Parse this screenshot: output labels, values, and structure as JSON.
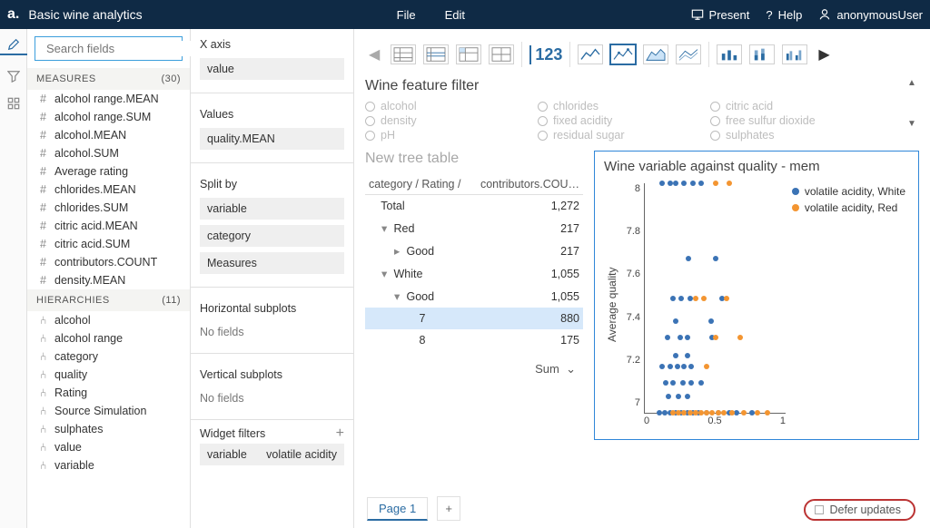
{
  "header": {
    "logo": "a.",
    "title": "Basic wine analytics",
    "menu": [
      "File",
      "Edit"
    ],
    "present": "Present",
    "help": "Help",
    "user": "anonymousUser"
  },
  "search": {
    "placeholder": "Search fields"
  },
  "measures": {
    "title": "MEASURES",
    "count": "(30)",
    "items": [
      "alcohol range.MEAN",
      "alcohol range.SUM",
      "alcohol.MEAN",
      "alcohol.SUM",
      "Average rating",
      "chlorides.MEAN",
      "chlorides.SUM",
      "citric acid.MEAN",
      "citric acid.SUM",
      "contributors.COUNT",
      "density.MEAN"
    ]
  },
  "hierarchies": {
    "title": "HIERARCHIES",
    "count": "(11)",
    "items": [
      "alcohol",
      "alcohol range",
      "category",
      "quality",
      "Rating",
      "Source Simulation",
      "sulphates",
      "value",
      "variable"
    ]
  },
  "config": {
    "x_axis_label": "X axis",
    "x_axis_chip": "value",
    "values_label": "Values",
    "values_chip": "quality.MEAN",
    "split_label": "Split by",
    "split_chips": [
      "variable",
      "category",
      "Measures"
    ],
    "h_sub_label": "Horizontal subplots",
    "v_sub_label": "Vertical subplots",
    "no_fields": "No fields",
    "filters_label": "Widget filters",
    "filter_chip_key": "variable",
    "filter_chip_val": "volatile acidity"
  },
  "toolbar_number": "123",
  "filter": {
    "title": "Wine feature filter",
    "items": [
      "alcohol",
      "chlorides",
      "citric acid",
      "density",
      "fixed acidity",
      "free sulfur dioxide",
      "pH",
      "residual sugar",
      "sulphates"
    ]
  },
  "table": {
    "title": "New tree table",
    "col1": "category / Rating / ",
    "col2": "contributors.COU…",
    "rows": [
      {
        "label": "Total",
        "value": "1,272",
        "indent": 0,
        "caret": "",
        "sel": false
      },
      {
        "label": "Red",
        "value": "217",
        "indent": 1,
        "caret": "▾",
        "sel": false
      },
      {
        "label": "Good",
        "value": "217",
        "indent": 2,
        "caret": "▸",
        "sel": false
      },
      {
        "label": "White",
        "value": "1,055",
        "indent": 1,
        "caret": "▾",
        "sel": false
      },
      {
        "label": "Good",
        "value": "1,055",
        "indent": 2,
        "caret": "▾",
        "sel": false
      },
      {
        "label": "7",
        "value": "880",
        "indent": 3,
        "caret": "",
        "sel": true
      },
      {
        "label": "8",
        "value": "175",
        "indent": 3,
        "caret": "",
        "sel": false
      }
    ],
    "sum": "Sum"
  },
  "chart": {
    "title": "Wine variable against quality - mem",
    "ylabel": "Average quality",
    "legend": [
      "volatile acidity, White",
      "volatile acidity, Red"
    ]
  },
  "chart_data": {
    "type": "scatter",
    "title": "Wine variable against quality - mem",
    "xlabel": "",
    "ylabel": "Average quality",
    "xlim": [
      0,
      1
    ],
    "ylim": [
      7,
      8
    ],
    "xticks": [
      0,
      0.5,
      1
    ],
    "yticks": [
      7,
      7.2,
      7.4,
      7.6,
      7.8,
      8
    ],
    "series": [
      {
        "name": "volatile acidity, White",
        "color": "#3b73b5",
        "points": [
          {
            "x": 0.12,
            "y": 8.0
          },
          {
            "x": 0.18,
            "y": 8.0
          },
          {
            "x": 0.22,
            "y": 8.0
          },
          {
            "x": 0.28,
            "y": 8.0
          },
          {
            "x": 0.34,
            "y": 8.0
          },
          {
            "x": 0.4,
            "y": 8.0
          },
          {
            "x": 0.31,
            "y": 7.67
          },
          {
            "x": 0.5,
            "y": 7.67
          },
          {
            "x": 0.2,
            "y": 7.5
          },
          {
            "x": 0.26,
            "y": 7.5
          },
          {
            "x": 0.32,
            "y": 7.5
          },
          {
            "x": 0.55,
            "y": 7.5
          },
          {
            "x": 0.22,
            "y": 7.4
          },
          {
            "x": 0.47,
            "y": 7.4
          },
          {
            "x": 0.16,
            "y": 7.33
          },
          {
            "x": 0.25,
            "y": 7.33
          },
          {
            "x": 0.3,
            "y": 7.33
          },
          {
            "x": 0.48,
            "y": 7.33
          },
          {
            "x": 0.22,
            "y": 7.25
          },
          {
            "x": 0.3,
            "y": 7.25
          },
          {
            "x": 0.12,
            "y": 7.2
          },
          {
            "x": 0.18,
            "y": 7.2
          },
          {
            "x": 0.23,
            "y": 7.2
          },
          {
            "x": 0.28,
            "y": 7.2
          },
          {
            "x": 0.33,
            "y": 7.2
          },
          {
            "x": 0.15,
            "y": 7.13
          },
          {
            "x": 0.2,
            "y": 7.13
          },
          {
            "x": 0.27,
            "y": 7.13
          },
          {
            "x": 0.33,
            "y": 7.13
          },
          {
            "x": 0.4,
            "y": 7.13
          },
          {
            "x": 0.17,
            "y": 7.07
          },
          {
            "x": 0.24,
            "y": 7.07
          },
          {
            "x": 0.3,
            "y": 7.07
          },
          {
            "x": 0.1,
            "y": 7.0
          },
          {
            "x": 0.14,
            "y": 7.0
          },
          {
            "x": 0.18,
            "y": 7.0
          },
          {
            "x": 0.22,
            "y": 7.0
          },
          {
            "x": 0.26,
            "y": 7.0
          },
          {
            "x": 0.3,
            "y": 7.0
          },
          {
            "x": 0.34,
            "y": 7.0
          },
          {
            "x": 0.38,
            "y": 7.0
          },
          {
            "x": 0.44,
            "y": 7.0
          },
          {
            "x": 0.52,
            "y": 7.0
          },
          {
            "x": 0.6,
            "y": 7.0
          },
          {
            "x": 0.65,
            "y": 7.0
          },
          {
            "x": 0.76,
            "y": 7.0
          }
        ]
      },
      {
        "name": "volatile acidity, Red",
        "color": "#f39531",
        "points": [
          {
            "x": 0.5,
            "y": 8.0
          },
          {
            "x": 0.6,
            "y": 8.0
          },
          {
            "x": 0.36,
            "y": 7.5
          },
          {
            "x": 0.42,
            "y": 7.5
          },
          {
            "x": 0.58,
            "y": 7.5
          },
          {
            "x": 0.5,
            "y": 7.33
          },
          {
            "x": 0.68,
            "y": 7.33
          },
          {
            "x": 0.44,
            "y": 7.2
          },
          {
            "x": 0.2,
            "y": 7.0
          },
          {
            "x": 0.24,
            "y": 7.0
          },
          {
            "x": 0.28,
            "y": 7.0
          },
          {
            "x": 0.32,
            "y": 7.0
          },
          {
            "x": 0.36,
            "y": 7.0
          },
          {
            "x": 0.4,
            "y": 7.0
          },
          {
            "x": 0.44,
            "y": 7.0
          },
          {
            "x": 0.48,
            "y": 7.0
          },
          {
            "x": 0.52,
            "y": 7.0
          },
          {
            "x": 0.56,
            "y": 7.0
          },
          {
            "x": 0.62,
            "y": 7.0
          },
          {
            "x": 0.7,
            "y": 7.0
          },
          {
            "x": 0.8,
            "y": 7.0
          },
          {
            "x": 0.87,
            "y": 7.0
          }
        ]
      }
    ]
  },
  "footer": {
    "page_label": "Page 1",
    "defer_label": "Defer updates"
  }
}
